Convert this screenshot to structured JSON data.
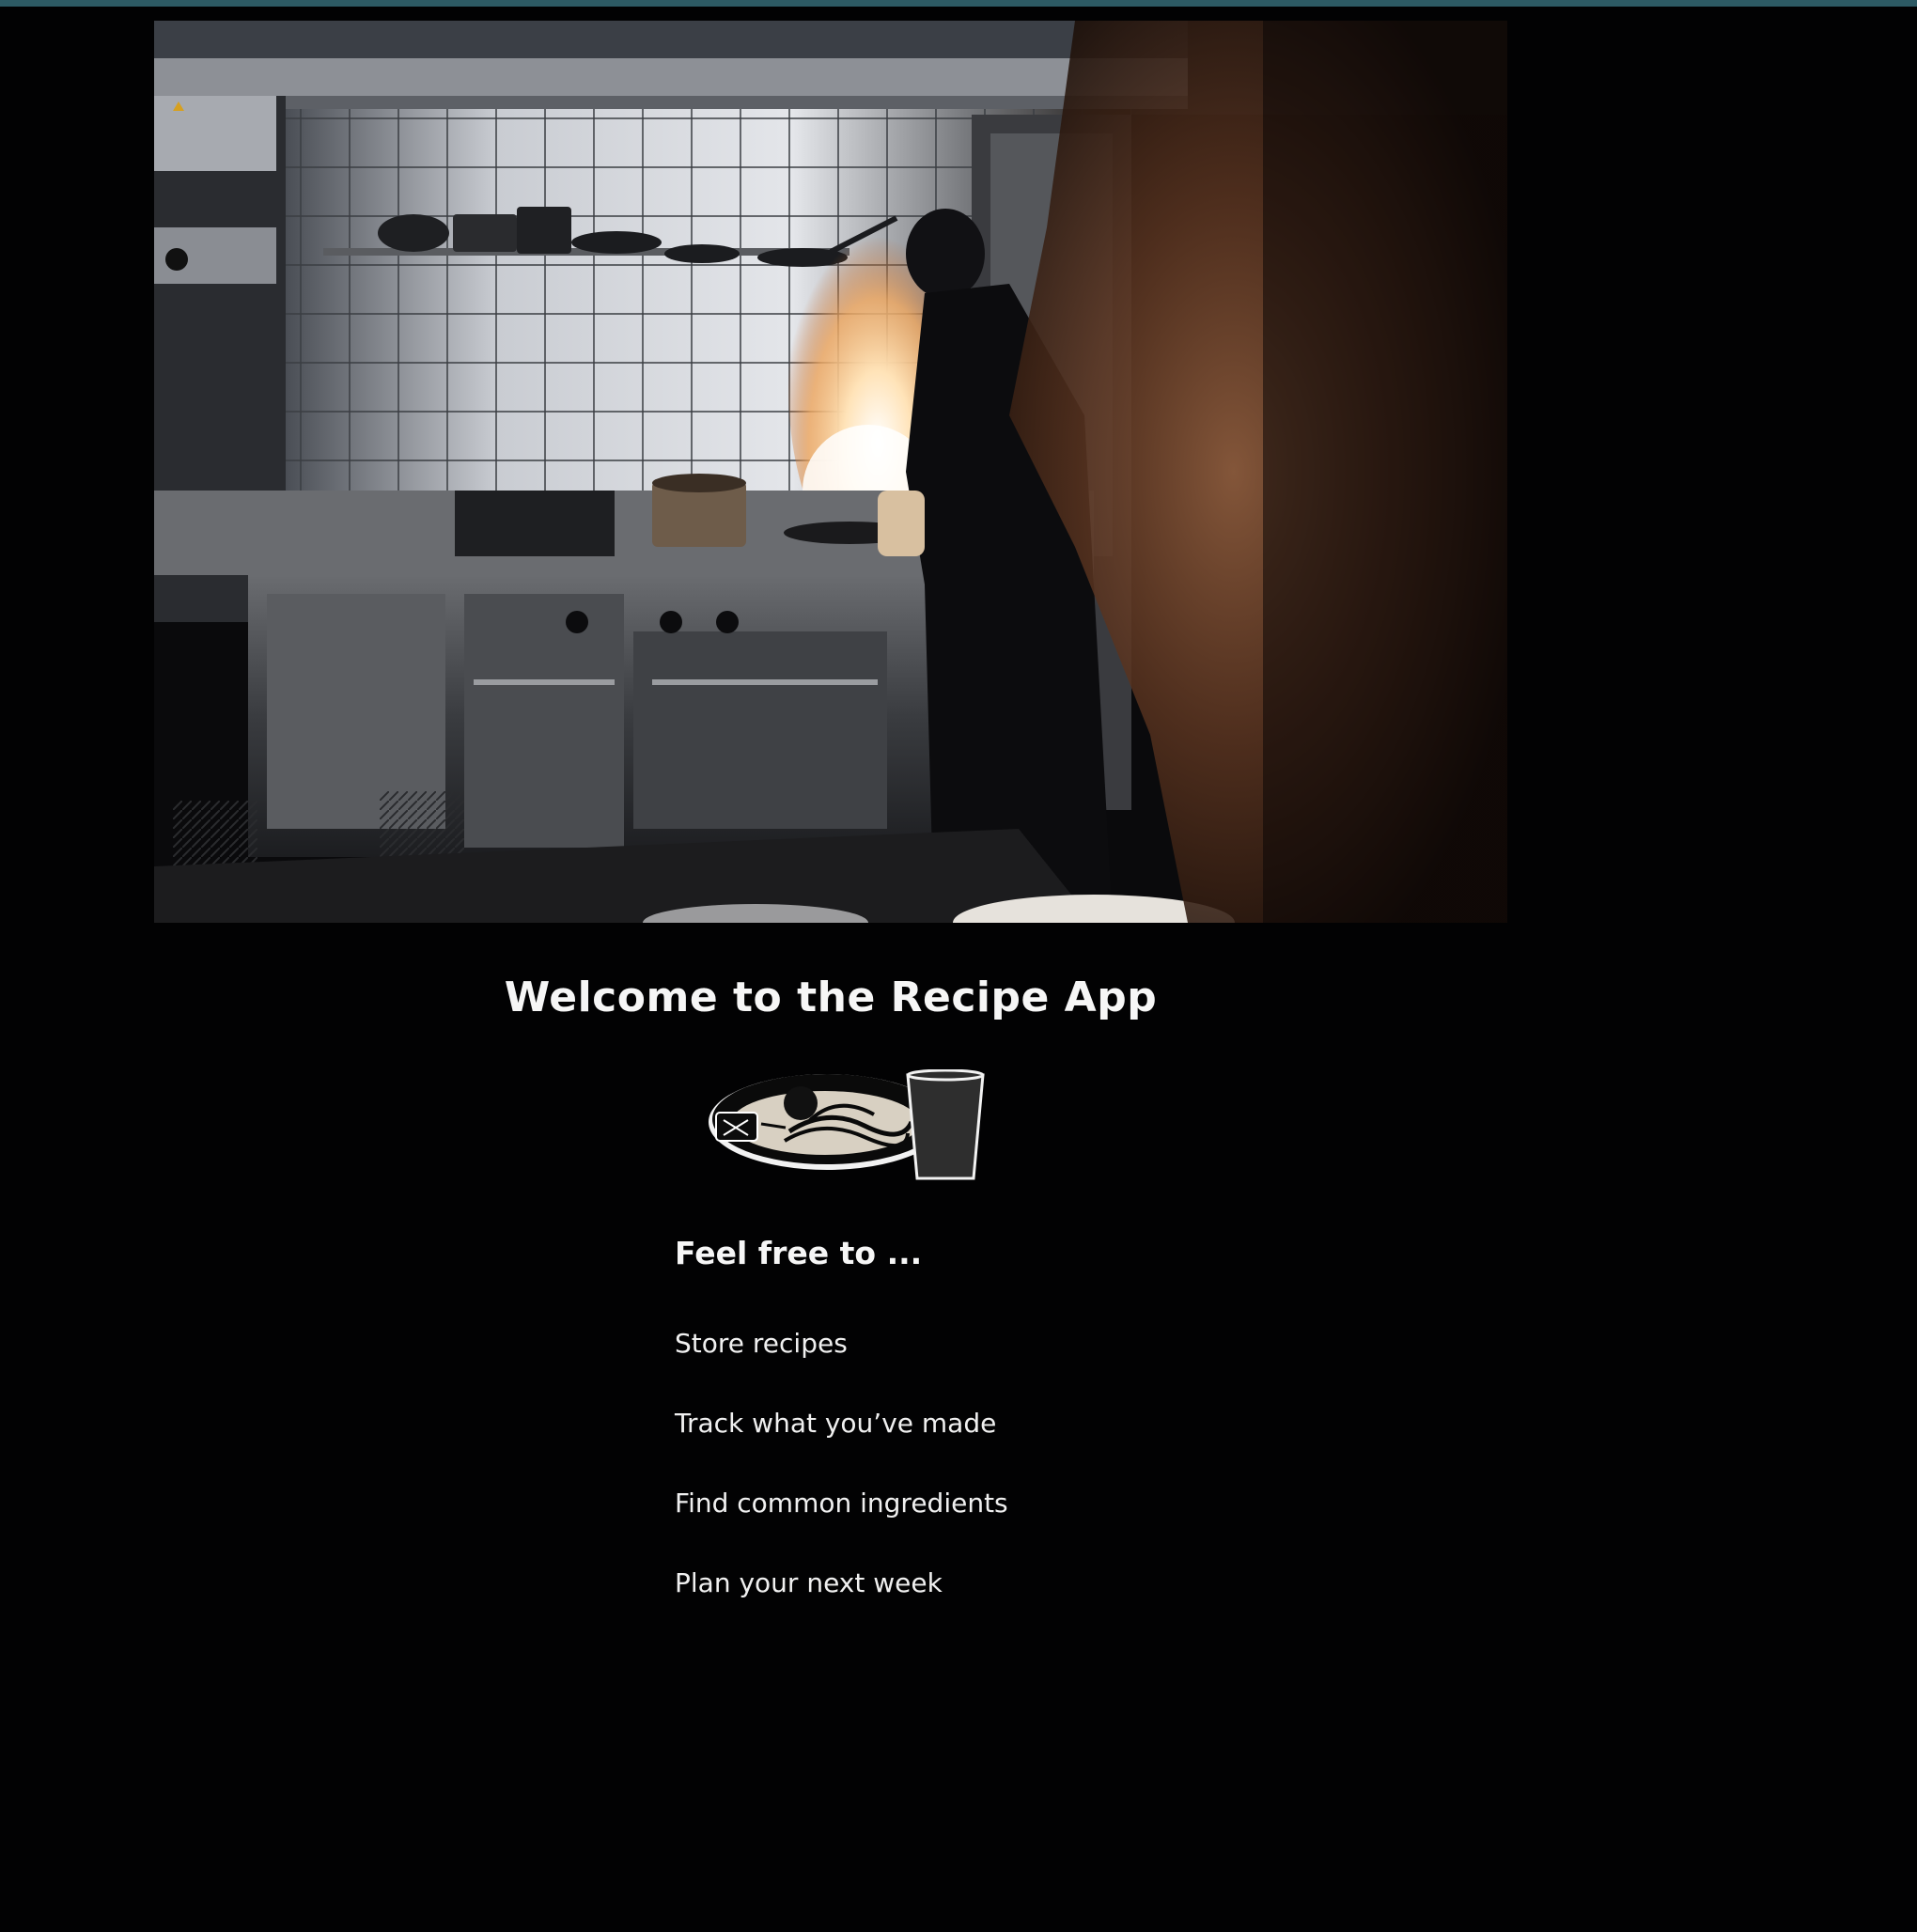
{
  "page": {
    "welcome_title": "Welcome to the Recipe App",
    "features_heading": "Feel free to ...",
    "features": [
      "Store recipes",
      "Track what you’ve made",
      "Find common ingredients",
      "Plan your next week"
    ]
  },
  "hero": {
    "icon": "kitchen-photo"
  },
  "colors": {
    "background": "#020203",
    "top_strip": "#2d5a64",
    "text": "#f4f4f4"
  }
}
